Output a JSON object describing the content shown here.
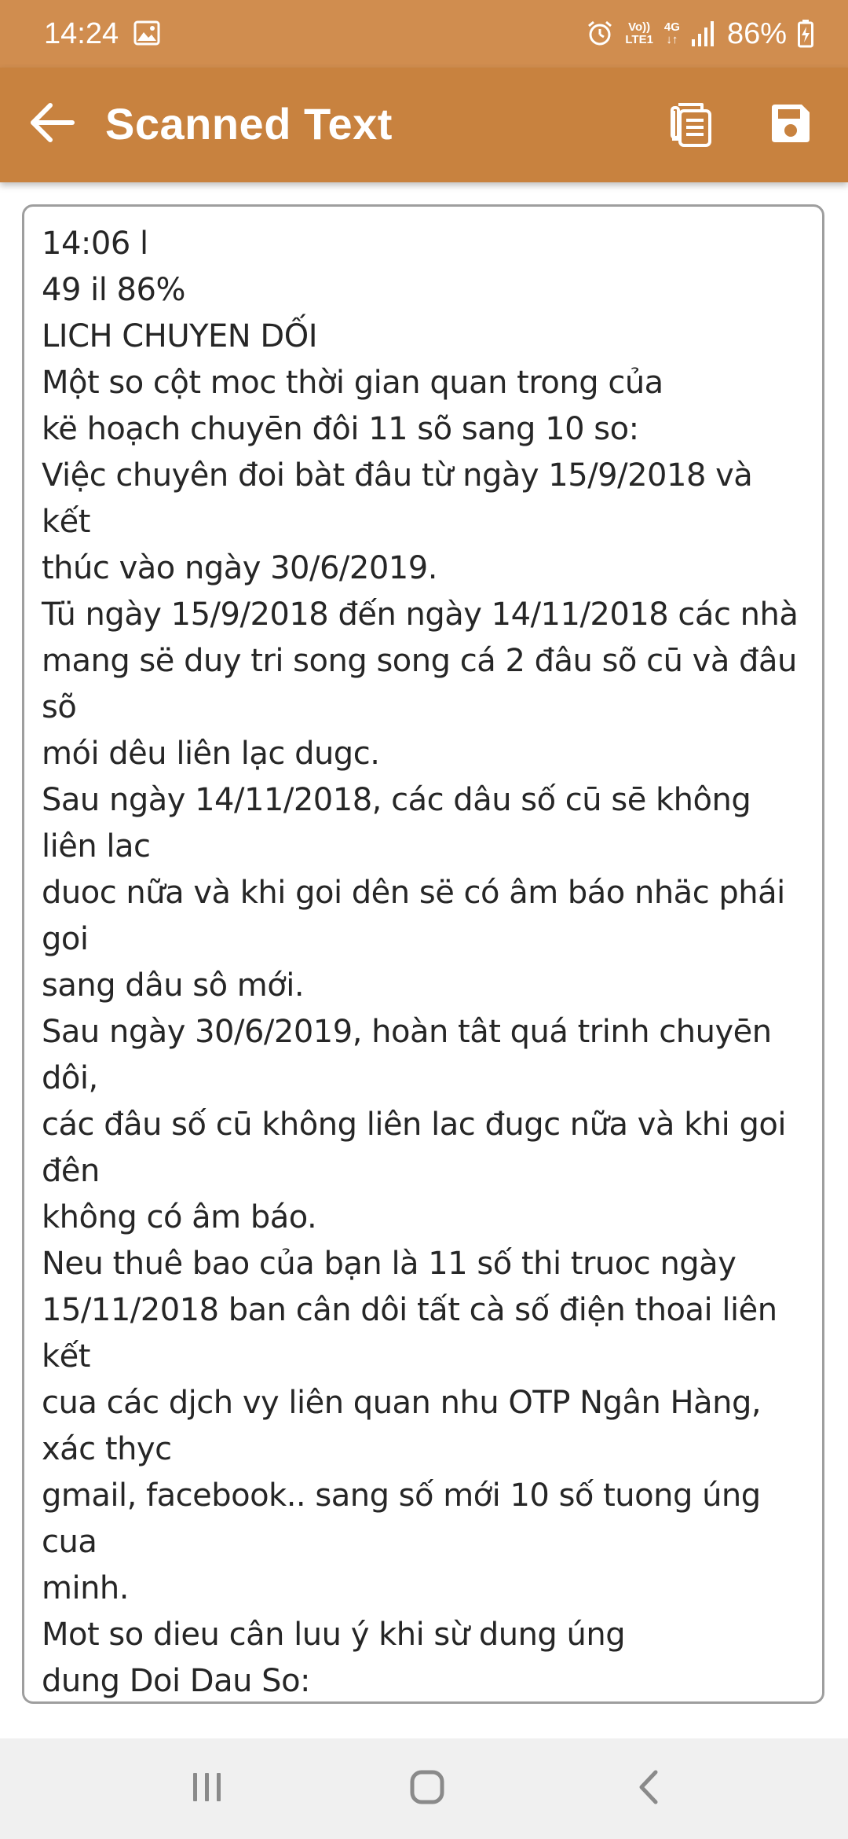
{
  "status_bar": {
    "time": "14:24",
    "battery": "86%",
    "network": "4G",
    "volte": "Vo))",
    "lte": "LTE1",
    "icons": [
      "gallery-icon",
      "alarm-icon",
      "volte-icon",
      "4g-icon",
      "signal-icon",
      "battery-charging-icon"
    ]
  },
  "app_bar": {
    "title": "Scanned Text",
    "icons": [
      "back-arrow-icon",
      "copy-icon",
      "save-icon"
    ]
  },
  "scanned_text": "14:06 l\n49 il 86%\nLICH CHUYEN DỐI\nMột so cột moc thời gian quan trong của\nkë hoạch chuyēn đôi 11 sõ sang 10 so:\nViệc chuyên đoi bàt đâu từ ngày 15/9/2018 và\nkết\nthúc vào ngày 30/6/2019.\nTü ngày 15/9/2018 đến ngày 14/11/2018 các nhà\nmang së duy tri song song cá 2 đâu sõ cū và đâu\nsõ\nmói dêu liên lạc dugc.\nSau ngày 14/11/2018, các dâu số cū sē không\nliên lac\nduoc nữa và khi goi dên së có âm báo nhäc phái\ngoi\nsang dâu sô mới.\nSau ngày 30/6/2019, hoàn tât quá trinh chuyēn\ndôi,\ncác đâu số cū không liên lac đugc nữa và khi goi\nđên\nkhông có âm báo.\nNeu thuê bao của bạn là 11 số thi truoc ngày\n15/11/2018 ban cân dôi tất cà số điện thoai liên\nkết\ncua các djch vy liên quan nhu OTP Ngân Hàng,\nxác thyc\ngmail, facebook.. sang số mới 10 số tuong úng\ncua\nminh.\nMot so dieu cân luu ý khi sừ dung úng\ndung Doi Dau So:",
  "nav_bar": {
    "icons": [
      "recents-icon",
      "home-icon",
      "back-icon"
    ]
  },
  "colors": {
    "status_bar": "#d08d4f",
    "app_bar": "#c8823f",
    "text": "#262626",
    "nav_bar": "#f0f0f0"
  }
}
